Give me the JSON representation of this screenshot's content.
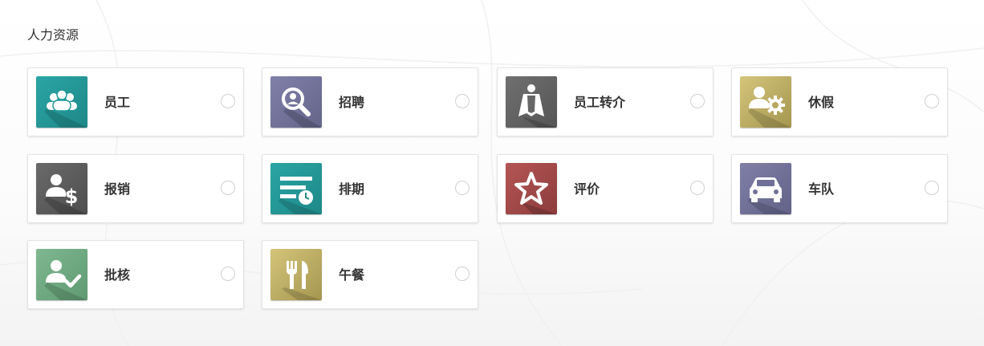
{
  "section": {
    "title": "人力资源"
  },
  "apps": [
    {
      "label": "员工",
      "icon": "people-group-icon",
      "color_light": "#2aa5a5",
      "color_dark": "#1f8888"
    },
    {
      "label": "招聘",
      "icon": "magnifier-icon",
      "color_light": "#8080aa",
      "color_dark": "#65658a"
    },
    {
      "label": "员工转介",
      "icon": "superhero-cape-icon",
      "color_light": "#707070",
      "color_dark": "#555555"
    },
    {
      "label": "休假",
      "icon": "user-gear-icon",
      "color_light": "#d4c57a",
      "color_dark": "#b3a45a"
    },
    {
      "label": "报销",
      "icon": "user-dollar-icon",
      "color_light": "#6a6a6a",
      "color_dark": "#4e4e4e"
    },
    {
      "label": "排期",
      "icon": "schedule-lines-icon",
      "color_light": "#2aa5a5",
      "color_dark": "#1f8888"
    },
    {
      "label": "评价",
      "icon": "star-icon",
      "color_light": "#b55555",
      "color_dark": "#8c3c3c"
    },
    {
      "label": "车队",
      "icon": "car-icon",
      "color_light": "#7f7fa8",
      "color_dark": "#636388"
    },
    {
      "label": "批核",
      "icon": "user-check-icon",
      "color_light": "#7fb890",
      "color_dark": "#5f9a72"
    },
    {
      "label": "午餐",
      "icon": "fork-knife-icon",
      "color_light": "#d4c57a",
      "color_dark": "#b3a45a"
    }
  ]
}
